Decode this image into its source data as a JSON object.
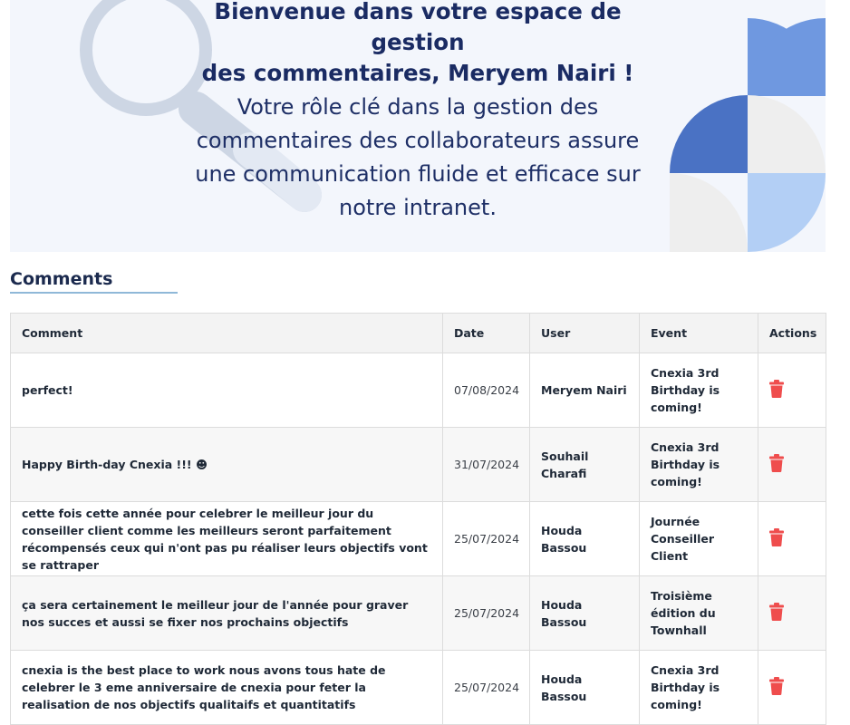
{
  "hero": {
    "title_line1": "Bienvenue dans votre espace de gestion",
    "title_line2": "des commentaires, Meryem Nairi !",
    "sub_line1": "Votre rôle clé dans la gestion des",
    "sub_line2": "commentaires des collaborateurs assure",
    "sub_line3": "une communication fluide et efficace sur",
    "sub_line4": "notre intranet.",
    "icons": [
      "magnifier-illustration",
      "quarter-circle-pattern"
    ],
    "colors": {
      "background": "#f3f6fc",
      "title": "#1a2b63",
      "accent_dark": "#4a72c4",
      "accent_mid": "#6f98e0",
      "accent_light": "#b3cff5"
    }
  },
  "section": {
    "title": "Comments"
  },
  "table": {
    "headers": {
      "comment": "Comment",
      "date": "Date",
      "user": "User",
      "event": "Event",
      "actions": "Actions"
    },
    "rows": [
      {
        "comment": "perfect!",
        "date": "07/08/2024",
        "user": "Meryem Nairi",
        "event": "Cnexia 3rd Birthday is coming!",
        "action_icon": "trash-icon"
      },
      {
        "comment": "Happy Birth-day Cnexia !!! ☻",
        "date": "31/07/2024",
        "user": "Souhail Charafi",
        "event": "Cnexia 3rd Birthday is coming!",
        "action_icon": "trash-icon"
      },
      {
        "comment": "cette fois cette année pour celebrer le meilleur jour du conseiller client comme les meilleurs seront parfaitement récompensés ceux qui n'ont pas pu réaliser leurs objectifs vont se rattraper",
        "date": "25/07/2024",
        "user": "Houda Bassou",
        "event": "Journée Conseiller Client",
        "action_icon": "trash-icon"
      },
      {
        "comment": "ça sera certainement le meilleur jour de l'année pour graver nos succes et aussi se fixer nos prochains objectifs",
        "date": "25/07/2024",
        "user": "Houda Bassou",
        "event": "Troisième édition du Townhall",
        "action_icon": "trash-icon"
      },
      {
        "comment": "cnexia is the best place to work nous avons tous hate de celebrer le 3 eme anniversaire de cnexia pour feter la realisation de nos objectifs qualitaifs et quantitatifs",
        "date": "25/07/2024",
        "user": "Houda Bassou",
        "event": "Cnexia 3rd Birthday is coming!",
        "action_icon": "trash-icon"
      }
    ],
    "colors": {
      "delete_icon": "#ef4d4d"
    }
  }
}
